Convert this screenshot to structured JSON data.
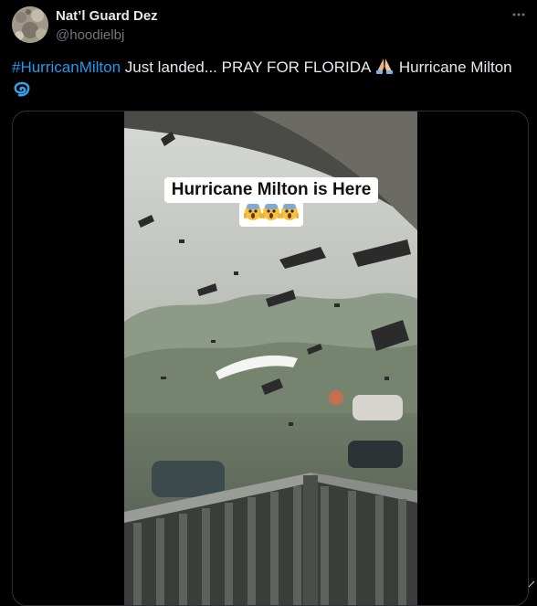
{
  "author": {
    "display_name": "Nat’l Guard Dez",
    "handle": "@hoodielbj",
    "avatar": "avatar-photo"
  },
  "header": {
    "more_icon": "more-horizontal-icon"
  },
  "tweet": {
    "hashtag": "#HurricanMilton",
    "text_main": " Just landed... PRAY FOR FLORIDA ",
    "text_after_pray": " Hurricane Milton ",
    "emojis": [
      "praying-hands-icon",
      "cyclone-icon"
    ]
  },
  "media": {
    "type": "video",
    "caption_line1": "Hurricane Milton is Here",
    "caption_emojis": [
      "screaming-face-icon",
      "screaming-face-icon",
      "screaming-face-icon"
    ]
  },
  "colors": {
    "background": "#000000",
    "text": "#e7e9ea",
    "secondary": "#71767b",
    "link": "#1d9bf0",
    "border": "#2f3336"
  }
}
